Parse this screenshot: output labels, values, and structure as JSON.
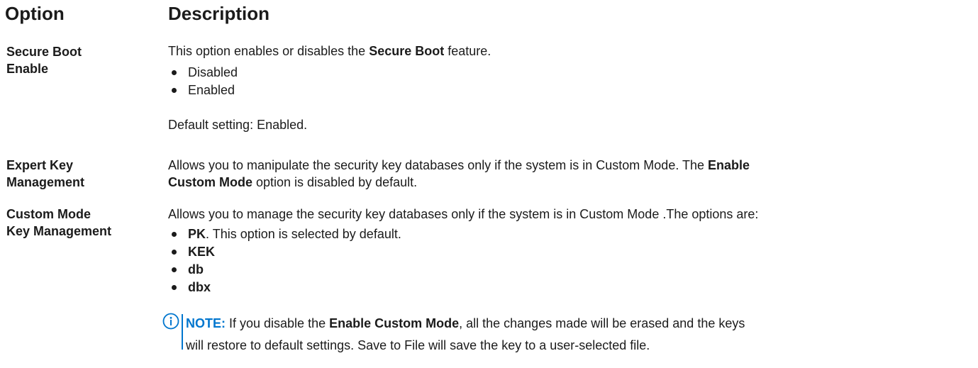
{
  "headers": {
    "option": "Option",
    "description": "Description"
  },
  "rows": [
    {
      "option_line1": "Secure Boot",
      "option_line2": "Enable",
      "desc_pre": "This option enables or disables the ",
      "desc_bold": "Secure Boot",
      "desc_post": " feature.",
      "items": [
        "Disabled",
        "Enabled"
      ],
      "default": "Default setting: Enabled."
    },
    {
      "option_line1": "Expert Key",
      "option_line2": "Management",
      "desc_line1_pre": "Allows you to manipulate the security key databases only if the system is in Custom Mode. The ",
      "desc_line1_bold": "Enable",
      "desc_line2_bold": "Custom Mode",
      "desc_line2_post": " option is disabled by default."
    },
    {
      "option_line1": "Custom Mode",
      "option_line2": "Key Management",
      "desc": "Allows you to manage the security key databases only if the system is in Custom Mode .The options are:",
      "items": [
        {
          "bold": "PK",
          "rest": ". This option is selected by default."
        },
        {
          "bold": "KEK",
          "rest": ""
        },
        {
          "bold": "db",
          "rest": ""
        },
        {
          "bold": "dbx",
          "rest": ""
        }
      ]
    }
  ],
  "note": {
    "icon": "info-circle-icon",
    "label": "NOTE:",
    "pre": " If you disable the ",
    "bold": "Enable Custom Mode",
    "post": ", all the changes made will be erased and the keys",
    "line2": "will restore to default settings. Save to File will save the key to a user-selected file."
  },
  "colors": {
    "text": "#1b1b1b",
    "accent": "#0076ce"
  }
}
